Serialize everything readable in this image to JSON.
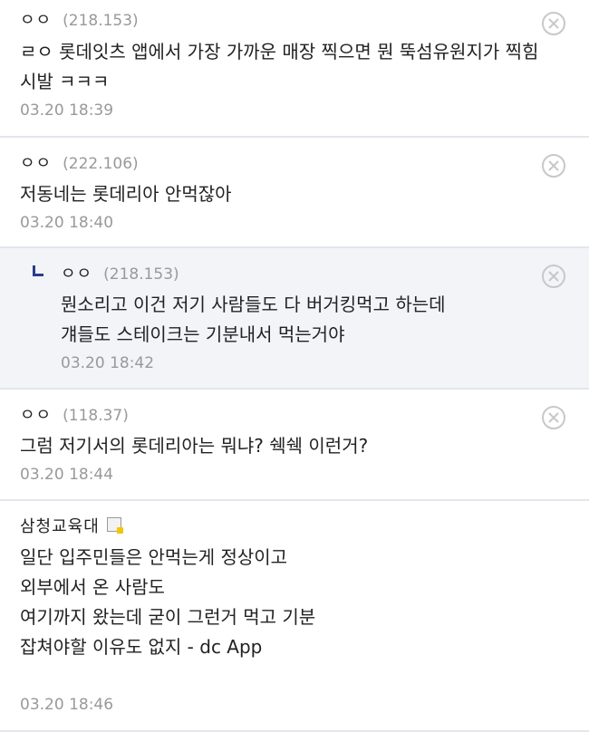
{
  "comments": [
    {
      "name": "ㅇㅇ",
      "ip": "(218.153)",
      "lines": [
        "ㄹㅇ 롯데잇츠 앱에서 가장 가까운 매장 찍으면 뭔 뚝섬유원지가 찍힘",
        "시발 ㅋㅋㅋ"
      ],
      "date": "03.20 18:39"
    },
    {
      "name": "ㅇㅇ",
      "ip": "(222.106)",
      "lines": [
        "저동네는 롯데리아 안먹잖아"
      ],
      "date": "03.20 18:40"
    },
    {
      "name": "ㅇㅇ",
      "ip": "(218.153)",
      "lines": [
        "뭔소리고 이건 저기 사람들도 다 버거킹먹고 하는데",
        "걔들도 스테이크는 기분내서 먹는거야"
      ],
      "date": "03.20 18:42"
    },
    {
      "name": "ㅇㅇ",
      "ip": "(118.37)",
      "lines": [
        "그럼 저기서의 롯데리아는 뭐냐? 쉑쉑 이런거?"
      ],
      "date": "03.20 18:44"
    },
    {
      "name": "삼청교육대",
      "lines": [
        "일단 입주민들은 안먹는게 정상이고",
        "",
        "외부에서 온 사람도",
        "여기까지 왔는데 굳이 그런거 먹고 기분",
        "잡쳐야할 이유도 없지 - dc App"
      ],
      "date": "03.20 18:46"
    }
  ]
}
